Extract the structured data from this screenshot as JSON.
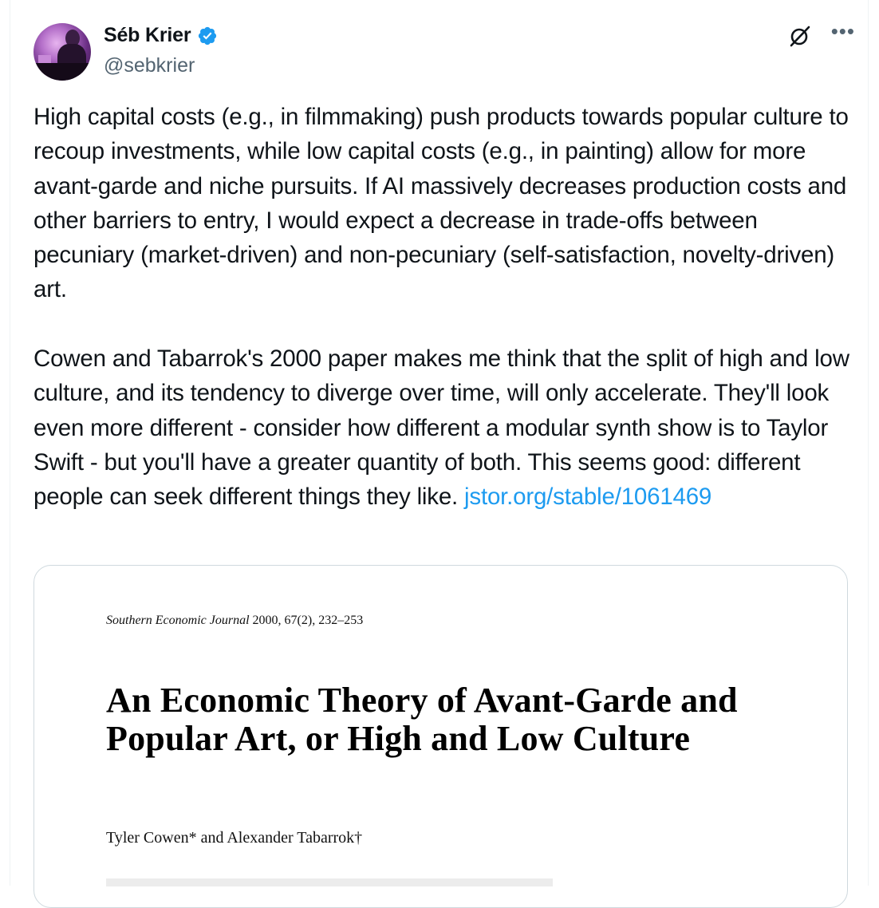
{
  "author": {
    "display_name": "Séb Krier",
    "handle": "@sebkrier",
    "verified": true
  },
  "icons": {
    "verified": "verified-badge-icon",
    "grok": "grok-icon",
    "more": "more-options-icon"
  },
  "colors": {
    "text": "#0f1419",
    "secondary": "#536471",
    "link": "#1d9bf0",
    "verified": "#1d9bf0",
    "border": "#cfd9de"
  },
  "tweet": {
    "paragraph1": "High capital costs (e.g., in filmmaking) push products towards popular culture to recoup investments, while low capital costs (e.g., in painting) allow for more avant-garde and niche pursuits. If AI massively decreases production costs and other barriers to entry, I would expect a decrease in trade-offs between pecuniary (market-driven) and non-pecuniary (self-satisfaction, novelty-driven) art.",
    "paragraph2": "Cowen and Tabarrok's 2000 paper makes me think that the split of high and low culture, and its tendency to diverge over time, will only accelerate. They'll look even more different - consider how different a modular synth show is to Taylor Swift - but you'll have a greater quantity of both. This seems good: different people can seek different things they like.",
    "link_text": "jstor.org/stable/1061469"
  },
  "media": {
    "journal_name": "Southern Economic Journal",
    "journal_citation": "2000, 67(2), 232–253",
    "title": "An Economic Theory of Avant-Garde and Popular Art, or High and Low Culture",
    "authors": "Tyler Cowen* and Alexander Tabarrok†"
  }
}
